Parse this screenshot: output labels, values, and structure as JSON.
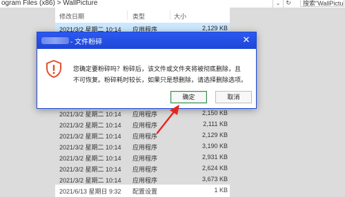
{
  "explorer": {
    "path_text": "ogram Files (x86)  >  WallPicture",
    "search_placeholder": "搜索\"WallPicture\"",
    "refresh_glyph": "↻",
    "dropdown_glyph": "⌄",
    "columns": {
      "date": "修改日期",
      "type": "类型",
      "size": "大小"
    },
    "rows": [
      {
        "date": "2021/3/2 星期二 10:14",
        "type": "应用程序",
        "size": "2,129 KB"
      },
      {
        "date": "2021/3/2 星期二 10:14",
        "type": "应用程序",
        "size": "2,150 KB"
      },
      {
        "date": "2021/3/2 星期二 10:14",
        "type": "应用程序",
        "size": "2,111 KB"
      },
      {
        "date": "2021/3/2 星期二 10:14",
        "type": "应用程序",
        "size": "2,129 KB"
      },
      {
        "date": "2021/3/2 星期二 10:14",
        "type": "应用程序",
        "size": "3,190 KB"
      },
      {
        "date": "2021/3/2 星期二 10:14",
        "type": "应用程序",
        "size": "2,931 KB"
      },
      {
        "date": "2021/3/2 星期二 10:14",
        "type": "应用程序",
        "size": "2,624 KB"
      },
      {
        "date": "2021/3/2 星期二 10:14",
        "type": "应用程序",
        "size": "3,673 KB"
      },
      {
        "date": "2021/6/13 星期日 9:32",
        "type": "配置设置",
        "size": "1 KB"
      }
    ]
  },
  "dialog": {
    "title": "- 文件粉碎",
    "close_glyph": "✕",
    "icon": "warning-shield-icon",
    "message_line1": "您确定要粉碎吗？粉碎后，该文件或文件夹将被彻底删除，且",
    "message_line2": "不可恢复。粉碎耗时较长，如果只是想删除，请选择删除选项。",
    "ok_label": "确定",
    "cancel_label": "取消"
  },
  "colors": {
    "titlebar": "#1e47d8",
    "selection": "#cce8ff",
    "annotation_arrow": "#e8231f",
    "warning_icon": "#e0502a"
  }
}
